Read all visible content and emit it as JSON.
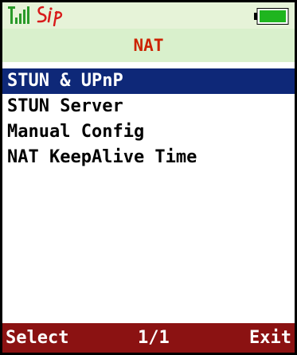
{
  "status_bar": {
    "signal_icon": "signal-strength-icon",
    "sip_label": "Sip",
    "battery_icon": "battery-full-icon",
    "background_color": "#e6f3d8"
  },
  "header": {
    "title": "NAT",
    "title_color": "#cc2200"
  },
  "menu": {
    "items": [
      {
        "label": "STUN & UPnP",
        "selected": true
      },
      {
        "label": "STUN Server",
        "selected": false
      },
      {
        "label": "Manual Config",
        "selected": false
      },
      {
        "label": "NAT KeepAlive Time",
        "selected": false
      }
    ],
    "selection_color": "#0e2878"
  },
  "softkeys": {
    "left": "Select",
    "center": "1/1",
    "right": "Exit",
    "background_color": "#8b1212"
  }
}
